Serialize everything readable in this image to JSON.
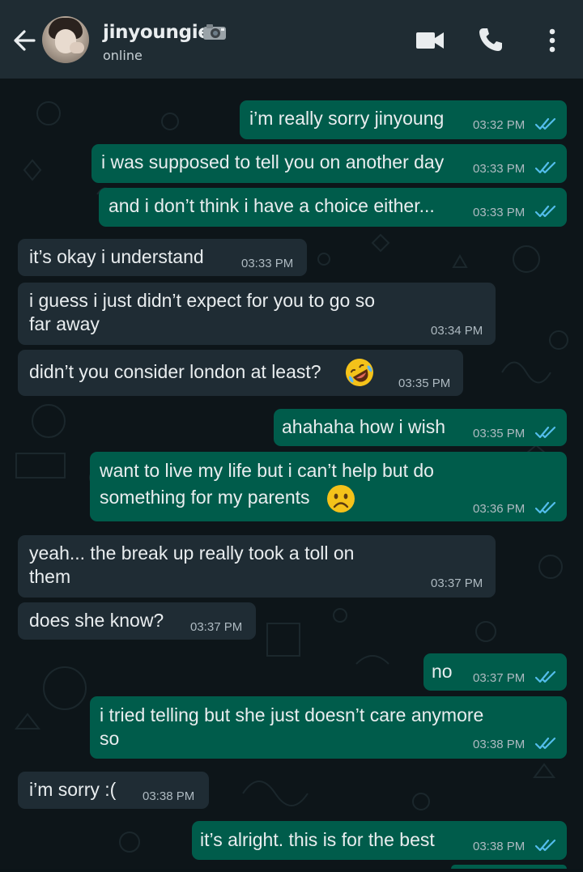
{
  "header": {
    "contact_name": "jinyoungie",
    "status": "online"
  },
  "messages": [
    {
      "text": "i’m really sorry jinyoung",
      "time": "03:32 PM"
    },
    {
      "text": "i was supposed to tell you on another day",
      "time": "03:33 PM"
    },
    {
      "text": "and i don’t think i have a choice either...",
      "time": "03:33 PM"
    },
    {
      "text": "it’s okay i understand",
      "time": "03:33 PM"
    },
    {
      "lines": [
        "i guess i just didn’t expect for you to go so",
        "far away"
      ],
      "time": "03:34 PM"
    },
    {
      "text": "didn’t you consider london at least?",
      "time": "03:35 PM"
    },
    {
      "text": "ahahaha how i wish",
      "time": "03:35 PM"
    },
    {
      "lines": [
        "want to live my life but i can’t help but do",
        "something for my parents"
      ],
      "time": "03:36 PM"
    },
    {
      "lines": [
        "yeah... the break up really took a toll on",
        "them"
      ],
      "time": "03:37 PM"
    },
    {
      "text": "does she know?",
      "time": "03:37 PM"
    },
    {
      "text": "no",
      "time": "03:37 PM"
    },
    {
      "lines": [
        "i tried telling but she just doesn’t care anymore",
        "so"
      ],
      "time": "03:38 PM"
    },
    {
      "text": "i’m sorry :(",
      "time": "03:38 PM"
    },
    {
      "text": "it’s alright. this is for the best",
      "time": "03:38 PM"
    }
  ],
  "icons": {
    "back": "arrow-left-icon",
    "video": "video-call-icon",
    "phone": "voice-call-icon",
    "menu": "more-vert-icon",
    "read_receipt": "double-check-icon",
    "camera_emoji": "camera-emoji",
    "laughing_emoji": "rolling-on-floor-laughing-emoji",
    "sad_emoji": "frowning-face-emoji"
  },
  "colors": {
    "header_bg": "#1f2c33",
    "chat_bg": "#0d1519",
    "outgoing_bubble": "#005c4b",
    "incoming_bubble": "#1f2c34",
    "read_check": "#53bdeb",
    "text": "#e9edef",
    "timestamp": "#aebac1"
  }
}
